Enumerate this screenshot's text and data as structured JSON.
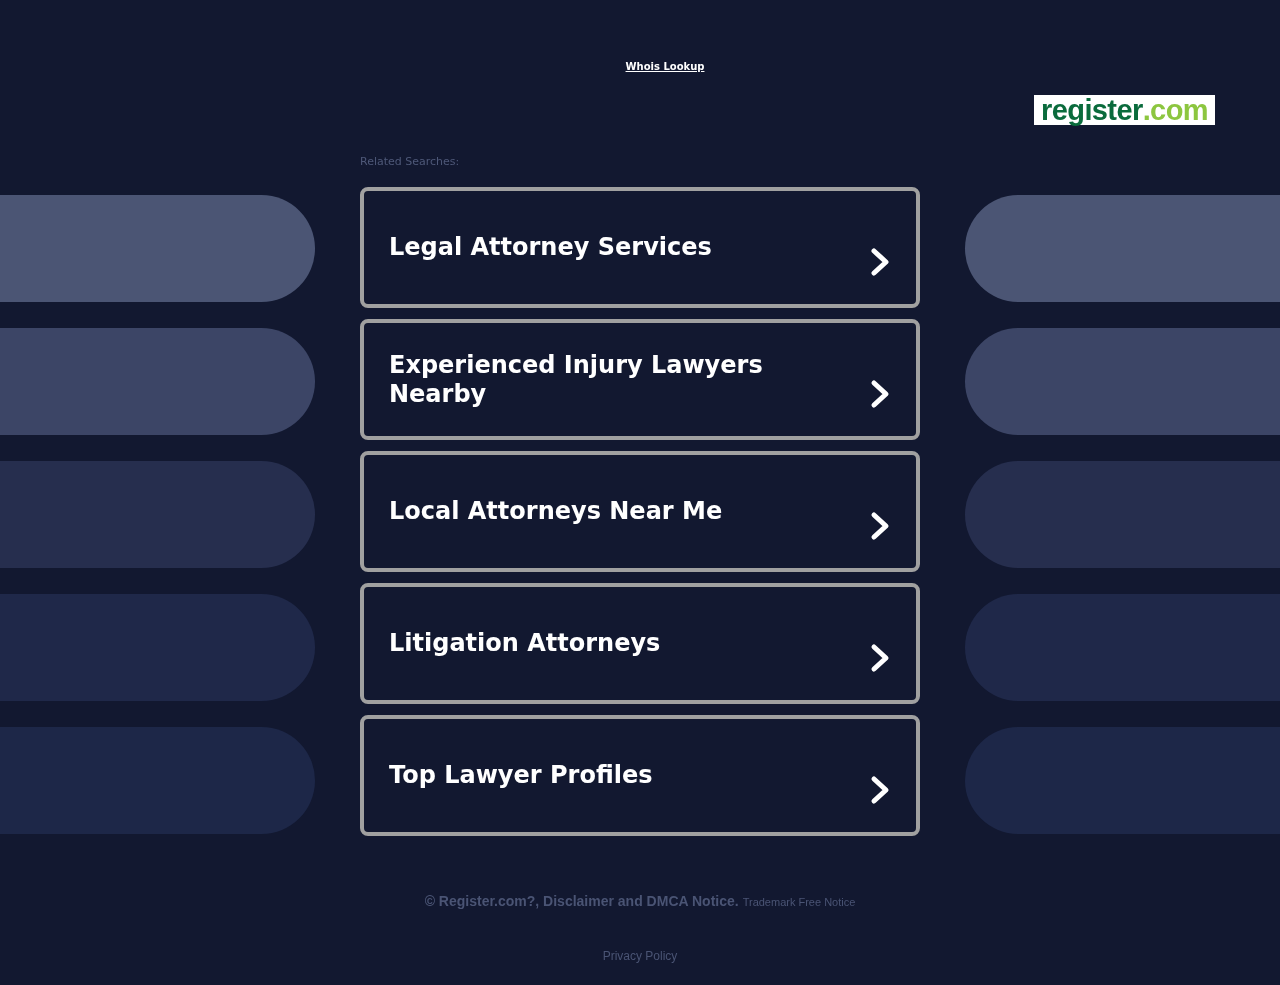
{
  "header": {
    "whois_link": "Whois Lookup"
  },
  "logo": {
    "name": "register",
    "suffix": ".com"
  },
  "related_searches": {
    "label": "Related Searches:",
    "items": [
      "Legal Attorney Services",
      "Experienced Injury Lawyers Nearby",
      "Local Attorneys Near Me",
      "Litigation Attorneys",
      "Top Lawyer Profiles"
    ]
  },
  "footer": {
    "copyright": "© Register.com?, Disclaimer and DMCA Notice.",
    "trademark_link": "Trademark Free Notice",
    "privacy_link": "Privacy Policy"
  }
}
